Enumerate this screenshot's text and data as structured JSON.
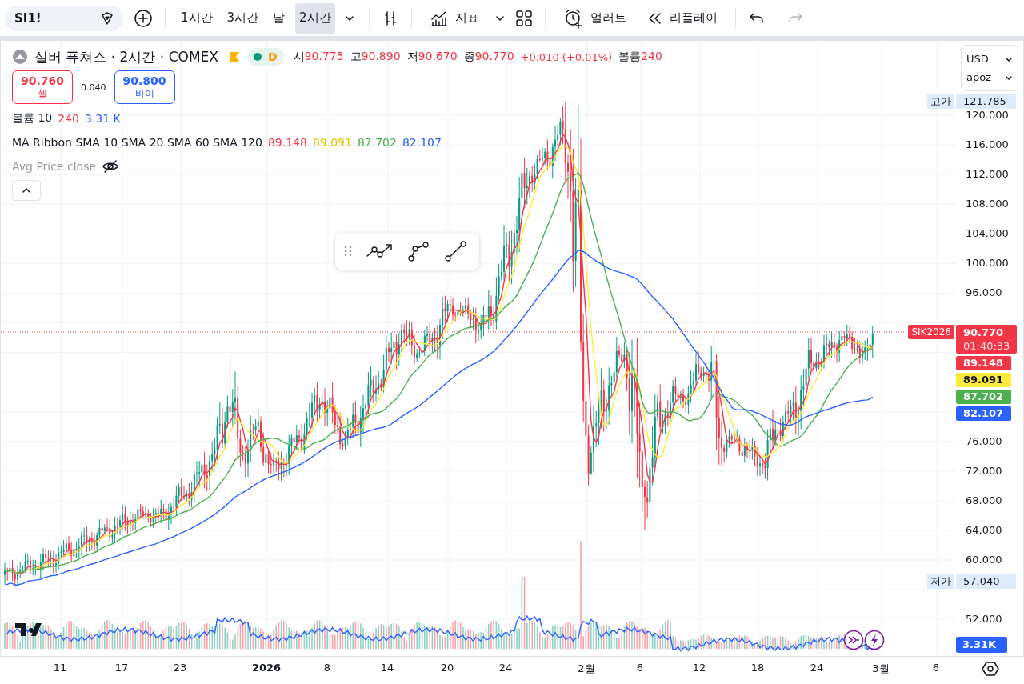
{
  "toolbar": {
    "symbol": "SI1!",
    "intervals": [
      {
        "label": "1시간",
        "selected": false
      },
      {
        "label": "3시간",
        "selected": false
      },
      {
        "label": "날",
        "selected": false
      },
      {
        "label": "2시간",
        "selected": true
      }
    ],
    "indicators": "지표",
    "alert": "얼러트",
    "replay": "리플레이",
    "redo_disabled": true
  },
  "legend": {
    "title": "실버 퓨쳐스 · 2시간 · COMEX",
    "session": "D",
    "ohlc": [
      {
        "label": "시",
        "value": "90.775"
      },
      {
        "label": "고",
        "value": "90.890"
      },
      {
        "label": "저",
        "value": "90.670"
      },
      {
        "label": "종",
        "value": "90.770"
      }
    ],
    "change": "+0.010 (+0.01%)",
    "volume_label": "볼륨",
    "volume": "240",
    "sell": {
      "price": "90.760",
      "label": "셀"
    },
    "spread": "0.040",
    "buy": {
      "price": "90.800",
      "label": "바이"
    },
    "volume_study": {
      "name": "볼륨 10",
      "value": "240",
      "average": "3.31 K"
    },
    "ma_study": {
      "name": "MA Ribbon SMA 10 SMA 20 SMA 60 SMA 120",
      "values": [
        {
          "value": "89.148",
          "color": "#f23645"
        },
        {
          "value": "89.091",
          "color": "#e0c400"
        },
        {
          "value": "87.702",
          "color": "#4caf50"
        },
        {
          "value": "82.107",
          "color": "#2962ff"
        }
      ]
    },
    "avg_study": {
      "name": "Avg Price close",
      "hidden": true
    }
  },
  "price_axis": {
    "currency": "USD",
    "unit": "apoz",
    "ticks": [
      "120.000",
      "116.000",
      "112.000",
      "108.000",
      "104.000",
      "100.000",
      "96.000",
      "76.000",
      "72.000",
      "68.000",
      "64.000",
      "60.000",
      "52.000"
    ],
    "high": {
      "label": "고가",
      "value": "121.785"
    },
    "low": {
      "label": "저가",
      "value": "57.040"
    },
    "last": {
      "symbol": "SIK2026",
      "price": "90.770",
      "countdown": "01:40:33"
    },
    "ma_tags": [
      {
        "value": "89.148",
        "color": "#f23645"
      },
      {
        "value": "89.091",
        "color": "#ffeb3b"
      },
      {
        "value": "87.702",
        "color": "#4caf50"
      },
      {
        "value": "82.107",
        "color": "#2962ff"
      }
    ],
    "volume_label": "3.31K"
  },
  "time_axis": {
    "labels": [
      {
        "text": "11",
        "bold": false
      },
      {
        "text": "17",
        "bold": false
      },
      {
        "text": "23",
        "bold": false
      },
      {
        "text": "2026",
        "bold": true
      },
      {
        "text": "8",
        "bold": false
      },
      {
        "text": "14",
        "bold": false
      },
      {
        "text": "20",
        "bold": false
      },
      {
        "text": "24",
        "bold": false
      },
      {
        "text": "2월",
        "bold": false
      },
      {
        "text": "6",
        "bold": false
      },
      {
        "text": "12",
        "bold": false
      },
      {
        "text": "18",
        "bold": false
      },
      {
        "text": "24",
        "bold": false
      },
      {
        "text": "3월",
        "bold": false
      },
      {
        "text": "6",
        "bold": false
      }
    ]
  }
}
